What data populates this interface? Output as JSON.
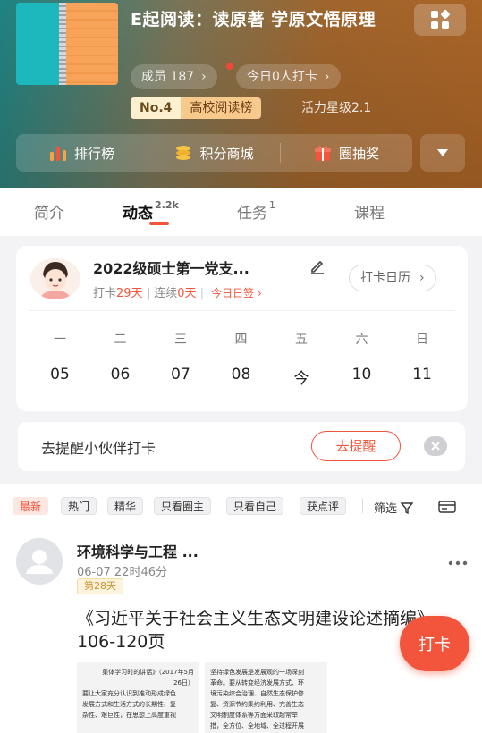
{
  "header": {
    "title": "E起阅读：读原著 学原文悟原理",
    "members": "成员 187",
    "today_checkins": "今日0人打卡",
    "rank_no": "No.4",
    "rank_board": "高校阅读榜",
    "vitality": "活力星级2.1",
    "actions": [
      {
        "label": "排行榜",
        "icon": "bar-chart-icon"
      },
      {
        "label": "积分商城",
        "icon": "coins-icon"
      },
      {
        "label": "圈抽奖",
        "icon": "gift-icon"
      }
    ],
    "colors": {
      "accent": "#f2553b",
      "header_left": "#1f8a8a",
      "header_right": "#b56a28"
    }
  },
  "tabs": [
    {
      "label": "简介",
      "badge": ""
    },
    {
      "label": "动态",
      "badge": "2.2k",
      "active": true
    },
    {
      "label": "任务",
      "badge": "1"
    },
    {
      "label": "课程",
      "badge": ""
    }
  ],
  "checkin": {
    "group_name": "2022级硕士第一党支...",
    "stats_prefix": "打卡",
    "days": "29天",
    "separator": " | 连续",
    "streak": "0天",
    "today_sign": "今日日签 ›",
    "calendar_button": "打卡日历",
    "weekdays": [
      "一",
      "二",
      "三",
      "四",
      "五",
      "六",
      "日"
    ],
    "dates": [
      "05",
      "06",
      "07",
      "08",
      "今",
      "10",
      "11"
    ]
  },
  "reminder": {
    "text": "去提醒小伙伴打卡",
    "button": "去提醒"
  },
  "filters": {
    "chips": [
      "最新",
      "热门",
      "精华",
      "只看圈主",
      "只看自己",
      "获点评"
    ],
    "filter_label": "筛选"
  },
  "post": {
    "author": "环境科学与工程 ...",
    "time": "06-07 22时46分",
    "badge": "第28天",
    "text": "《习近平关于社会主义生态文明建设论述摘编》106-120页",
    "image1_lines": [
      "集体学习时的讲话》（2017年5月",
      "26日）",
      "要让大家充分认识到推动形成绿色",
      "发展方式和生活方式的长期性、复",
      "杂性、艰巨性，在思想上高度重视"
    ],
    "image2_lines": [
      "坚持绿色发展是发展观的一场深刻",
      "革命。要从转变经济发展方式、环",
      "境污染综合治理、自然生态保护修",
      "复、资源节约集约利用、完善生态",
      "文明制度体系等方面采取超常举",
      "措，全方位、全地域、全过程开展"
    ]
  },
  "fab": {
    "label": "打卡"
  }
}
